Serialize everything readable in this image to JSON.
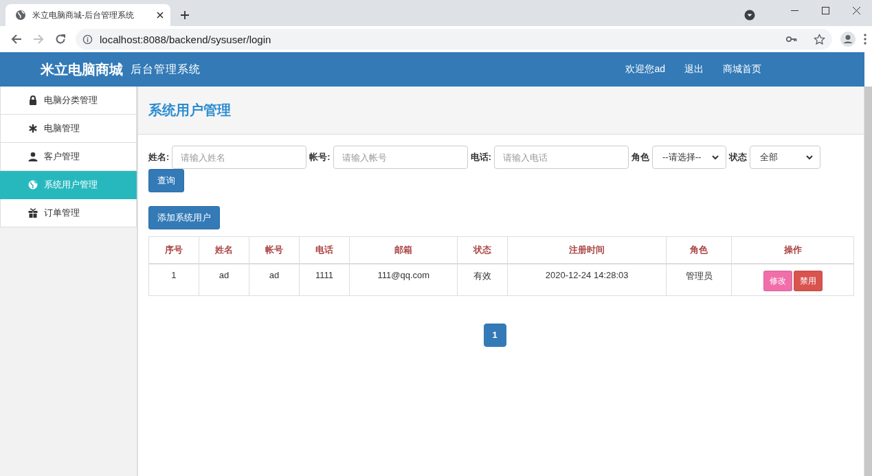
{
  "browser": {
    "tab_title": "米立电脑商城-后台管理系统",
    "url": "localhost:8088/backend/sysuser/login"
  },
  "navbar": {
    "brand": "米立电脑商城",
    "subtitle": "后台管理系统",
    "links": [
      "欢迎您ad",
      "退出",
      "商城首页"
    ]
  },
  "sidebar": {
    "items": [
      {
        "label": "电脑分类管理",
        "selected": false
      },
      {
        "label": "电脑管理",
        "selected": false
      },
      {
        "label": "客户管理",
        "selected": false
      },
      {
        "label": "系统用户管理",
        "selected": true
      },
      {
        "label": "订单管理",
        "selected": false
      }
    ]
  },
  "page_title": "系统用户管理",
  "filters": [
    {
      "kind": "input",
      "label": "姓名:",
      "placeholder": "请输入姓名"
    },
    {
      "kind": "input",
      "label": "帐号:",
      "placeholder": "请输入帐号"
    },
    {
      "kind": "input",
      "label": "电话:",
      "placeholder": "请输入电话"
    },
    {
      "kind": "select",
      "label": "角色",
      "value": "--请选择--"
    },
    {
      "kind": "select",
      "label": "状态",
      "value": "全部"
    }
  ],
  "search_button": "查询",
  "add_button": "添加系统用户",
  "table": {
    "columns": [
      "序号",
      "姓名",
      "帐号",
      "电话",
      "邮箱",
      "状态",
      "注册时间",
      "角色",
      "操作"
    ],
    "rows": [
      {
        "cells": [
          "1",
          "ad",
          "ad",
          "1111",
          "111@qq.com",
          "有效",
          "2020-12-24 14:28:03",
          "管理员"
        ],
        "actions": [
          {
            "label": "修改",
            "color": "#f06eaa"
          },
          {
            "label": "禁用",
            "color": "#d9534f"
          }
        ]
      }
    ]
  },
  "pagination": [
    {
      "label": "1",
      "selected": true
    }
  ]
}
